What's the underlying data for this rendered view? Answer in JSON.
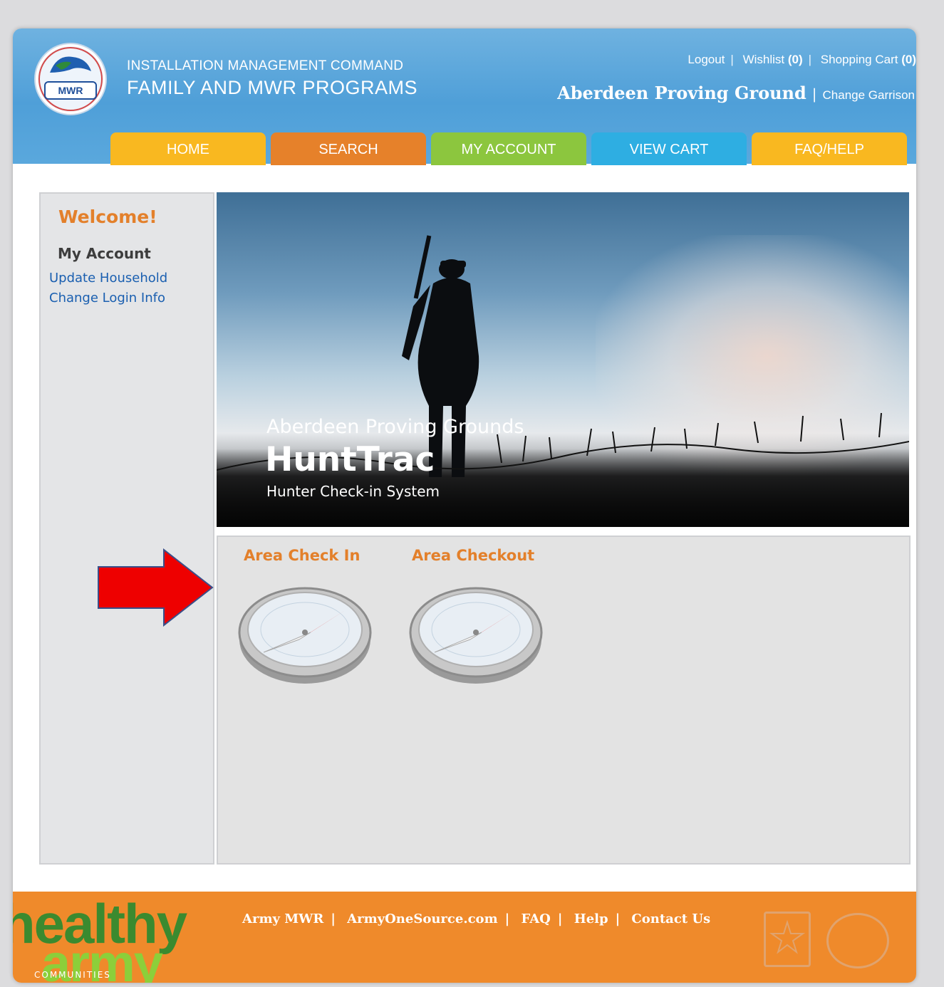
{
  "header": {
    "logo_text": "MWR",
    "org_line1": "INSTALLATION MANAGEMENT COMMAND",
    "org_line2": "FAMILY AND MWR PROGRAMS",
    "logout": "Logout",
    "wishlist_label": "Wishlist",
    "wishlist_count": "(0)",
    "cart_label": "Shopping Cart",
    "cart_count": "(0)",
    "garrison": "Aberdeen Proving Ground",
    "change_garrison": "Change Garrison"
  },
  "nav": {
    "tabs": [
      {
        "label": "HOME"
      },
      {
        "label": "SEARCH"
      },
      {
        "label": "MY ACCOUNT"
      },
      {
        "label": "VIEW CART"
      },
      {
        "label": "FAQ/HELP"
      }
    ]
  },
  "sidebar": {
    "welcome": "Welcome!",
    "section_title": "My Account",
    "links": [
      {
        "label": "Update Household"
      },
      {
        "label": "Change Login Info"
      }
    ]
  },
  "banner": {
    "subtitle": "Aberdeen Proving Grounds",
    "title": "HuntTrac",
    "tagline": "Hunter Check-in System"
  },
  "actions": [
    {
      "label": "Area Check In",
      "icon": "compass-icon"
    },
    {
      "label": "Area Checkout",
      "icon": "compass-icon"
    }
  ],
  "footer": {
    "logo_word1": "healthy",
    "logo_word2": "army",
    "logo_word3": "COMMUNITIES",
    "links": [
      {
        "label": "Army MWR"
      },
      {
        "label": "ArmyOneSource.com"
      },
      {
        "label": "FAQ"
      },
      {
        "label": "Help"
      },
      {
        "label": "Contact Us"
      }
    ]
  },
  "colors": {
    "header_blue": "#4f9fd8",
    "accent_orange": "#e3802b",
    "footer_orange": "#ef8a2b",
    "tab_home": "#f9b820",
    "tab_search": "#e6812a",
    "tab_account": "#8cc63e",
    "tab_cart": "#2eaee2",
    "tab_faq": "#f9b820",
    "arrow_red": "#ee0000"
  }
}
